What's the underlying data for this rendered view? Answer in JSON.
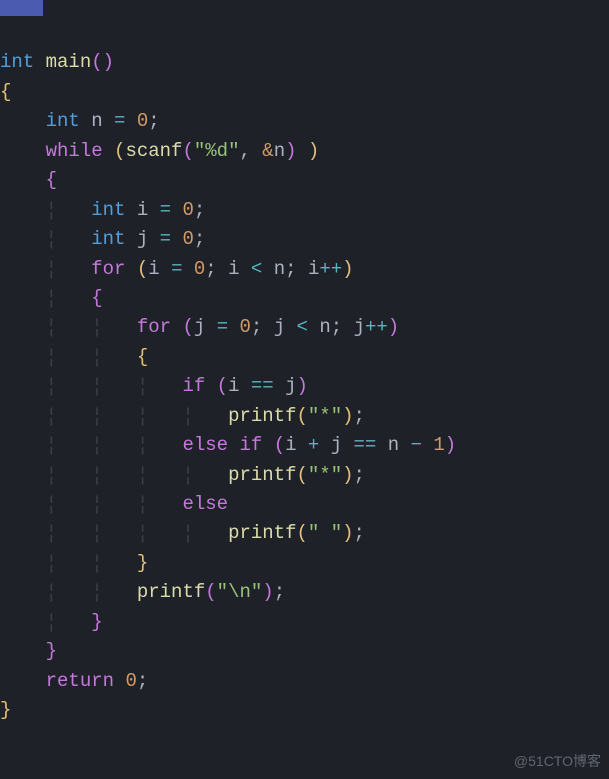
{
  "code": {
    "l1_type": "int",
    "l1_fn": "main",
    "l3_type": "int",
    "l3_var": "n",
    "l3_eq": "=",
    "l3_val": "0",
    "l4_kw": "while",
    "l4_paren_o": "(",
    "l4_fn": "scanf",
    "l4_po": "(",
    "l4_str": "\"%d\"",
    "l4_comma": ",",
    "l4_amp": "&",
    "l4_var": "n",
    "l4_pc": ")",
    "l4_paren_c": ")",
    "l5_brace": "{",
    "l6_type": "int",
    "l6_var": "i",
    "l6_eq": "=",
    "l6_val": "0",
    "l7_type": "int",
    "l7_var": "j",
    "l7_eq": "=",
    "l7_val": "0",
    "l8_kw": "for",
    "l8_po": "(",
    "l8_v1": "i",
    "l8_eq": "=",
    "l8_val": "0",
    "l8_s1": ";",
    "l8_v2": "i",
    "l8_lt": "<",
    "l8_v3": "n",
    "l8_s2": ";",
    "l8_v4": "i",
    "l8_inc": "++",
    "l8_pc": ")",
    "l9_brace": "{",
    "l10_kw": "for",
    "l10_po": "(",
    "l10_v1": "j",
    "l10_eq": "=",
    "l10_val": "0",
    "l10_s1": ";",
    "l10_v2": "j",
    "l10_lt": "<",
    "l10_v3": "n",
    "l10_s2": ";",
    "l10_v4": "j",
    "l10_inc": "++",
    "l10_pc": ")",
    "l11_brace": "{",
    "l12_kw": "if",
    "l12_po": "(",
    "l12_v1": "i",
    "l12_eq": "==",
    "l12_v2": "j",
    "l12_pc": ")",
    "l13_fn": "printf",
    "l13_po": "(",
    "l13_str": "\"*\"",
    "l13_pc": ")",
    "l14_kw1": "else",
    "l14_kw2": "if",
    "l14_po": "(",
    "l14_v1": "i",
    "l14_plus": "+",
    "l14_v2": "j",
    "l14_eq": "==",
    "l14_v3": "n",
    "l14_minus": "−",
    "l14_val": "1",
    "l14_pc": ")",
    "l15_fn": "printf",
    "l15_po": "(",
    "l15_str": "\"*\"",
    "l15_pc": ")",
    "l16_kw": "else",
    "l17_fn": "printf",
    "l17_po": "(",
    "l17_str": "\" \"",
    "l17_pc": ")",
    "l18_brace": "}",
    "l19_fn": "printf",
    "l19_po": "(",
    "l19_str": "\"\\n\"",
    "l19_pc": ")",
    "l20_brace": "}",
    "l21_brace": "}",
    "l22_kw": "return",
    "l22_val": "0",
    "l23_brace": "}"
  },
  "watermark": "@51CTO博客"
}
